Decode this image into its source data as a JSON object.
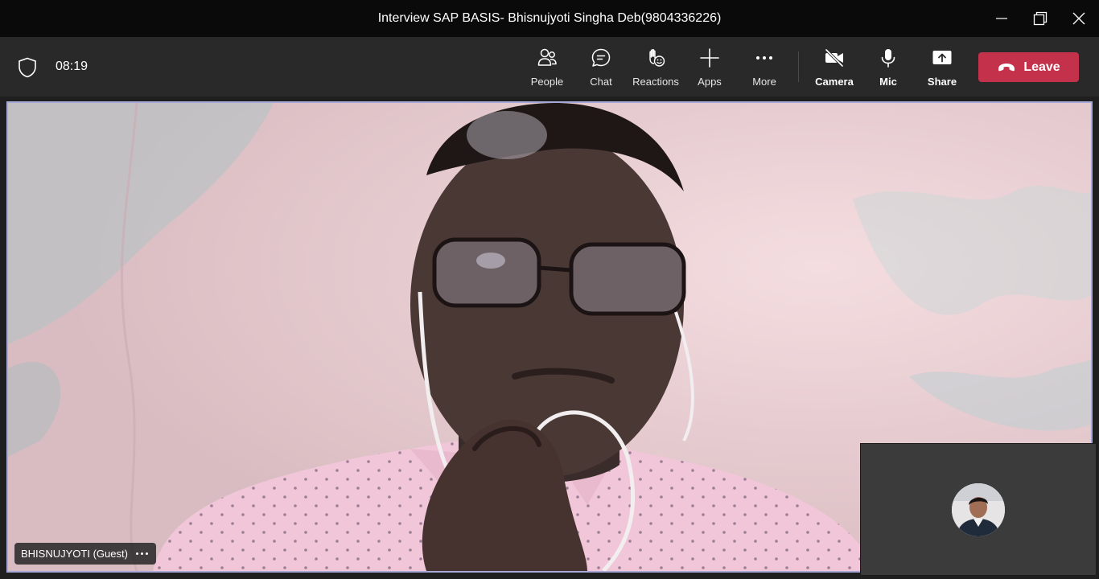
{
  "window": {
    "title": "Interview SAP BASIS- Bhisnujyoti Singha Deb(9804336226)"
  },
  "toolbar": {
    "timer": "08:19",
    "buttons": {
      "people": "People",
      "chat": "Chat",
      "reactions": "Reactions",
      "apps": "Apps",
      "more": "More",
      "camera": "Camera",
      "mic": "Mic",
      "share": "Share"
    },
    "leave_label": "Leave",
    "leave_color": "#c4314b"
  },
  "stage": {
    "participant_name": "BHISNUJYOTI (Guest)",
    "active_border_color": "#a7a9d8"
  },
  "icons": {
    "shield": "shield-icon",
    "people": "people-icon",
    "chat": "chat-icon",
    "reactions": "raise-hand-icon",
    "apps": "plus-icon",
    "more": "more-icon",
    "camera": "camera-off-icon",
    "mic": "mic-icon",
    "share": "share-icon",
    "leave": "phone-hangup-icon"
  }
}
